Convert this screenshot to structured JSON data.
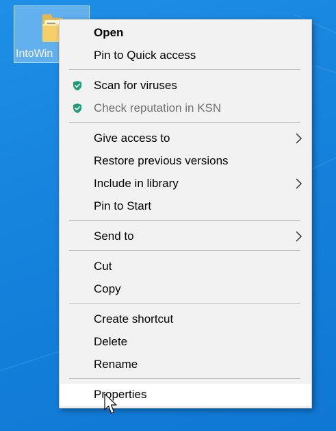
{
  "desktop": {
    "icon_label": "IntoWin",
    "icon_name": "folder-icon"
  },
  "context_menu": {
    "items": [
      {
        "label": "Open",
        "bold": true
      },
      {
        "label": "Pin to Quick access"
      },
      {
        "label": "Scan for viruses",
        "icon": "kaspersky-shield-icon"
      },
      {
        "label": "Check reputation in KSN",
        "icon": "kaspersky-shield-icon",
        "disabled": true
      },
      {
        "label": "Give access to",
        "submenu": true
      },
      {
        "label": "Restore previous versions"
      },
      {
        "label": "Include in library",
        "submenu": true
      },
      {
        "label": "Pin to Start"
      },
      {
        "label": "Send to",
        "submenu": true
      },
      {
        "label": "Cut"
      },
      {
        "label": "Copy"
      },
      {
        "label": "Create shortcut"
      },
      {
        "label": "Delete"
      },
      {
        "label": "Rename"
      },
      {
        "label": "Properties",
        "highlighted": true
      }
    ]
  },
  "colors": {
    "desktop_blue": "#1582dc",
    "menu_background": "#f2f2f2",
    "menu_highlight": "#ffffff",
    "shield_green": "#1a9e78",
    "disabled_text": "#6f6f6f"
  },
  "icons": [
    "folder-icon",
    "kaspersky-shield-icon",
    "chevron-right-icon",
    "mouse-pointer-icon"
  ]
}
